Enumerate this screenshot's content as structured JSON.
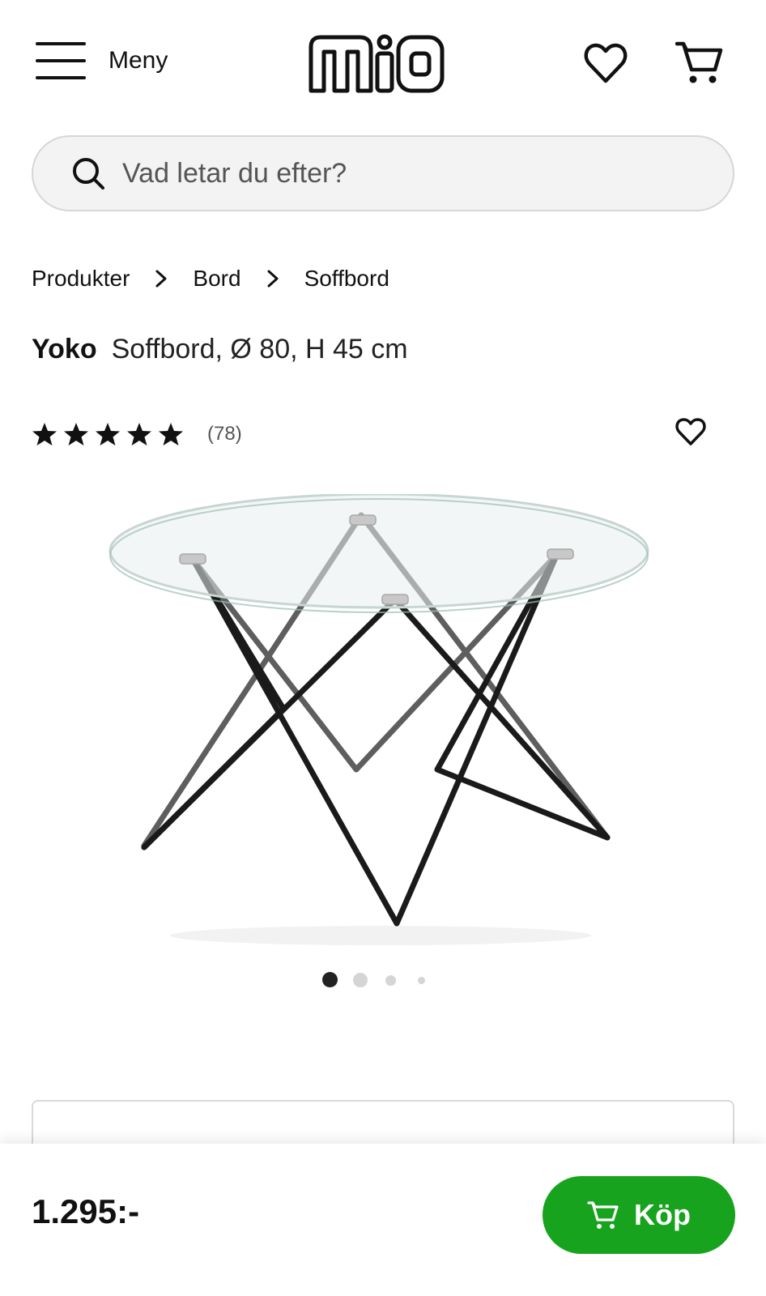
{
  "header": {
    "menu_label": "Meny",
    "logo_text": "mio"
  },
  "search": {
    "placeholder": "Vad letar du efter?"
  },
  "breadcrumb": {
    "items": [
      "Produkter",
      "Bord",
      "Soffbord"
    ]
  },
  "product": {
    "brand": "Yoko",
    "description": "Soffbord, Ø 80, H 45 cm",
    "rating": 5,
    "review_count": "(78)",
    "image_count": 4,
    "current_image": 1
  },
  "purchase": {
    "price": "1.295:-",
    "buy_label": "Köp"
  },
  "colors": {
    "accent_green": "#17a31d",
    "text": "#111111"
  },
  "icons": [
    "menu-icon",
    "heart-icon",
    "cart-icon",
    "search-icon",
    "chevron-right-icon",
    "star-icon"
  ]
}
